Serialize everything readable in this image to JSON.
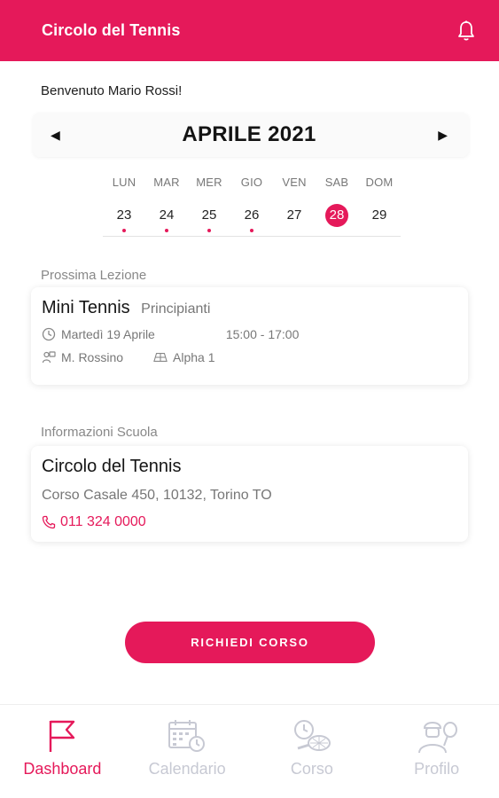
{
  "appbar": {
    "title": "Circolo del Tennis",
    "bell_icon": "bell-icon"
  },
  "welcome": "Benvenuto Mario Rossi!",
  "calendar": {
    "month": "APRILE 2021",
    "prev_arrow": "◀",
    "next_arrow": "▶",
    "days": [
      {
        "name": "LUN",
        "num": "23",
        "dot": true,
        "selected": false
      },
      {
        "name": "MAR",
        "num": "24",
        "dot": true,
        "selected": false
      },
      {
        "name": "MER",
        "num": "25",
        "dot": true,
        "selected": false
      },
      {
        "name": "GIO",
        "num": "26",
        "dot": true,
        "selected": false
      },
      {
        "name": "VEN",
        "num": "27",
        "dot": false,
        "selected": false
      },
      {
        "name": "SAB",
        "num": "28",
        "dot": false,
        "selected": true
      },
      {
        "name": "DOM",
        "num": "29",
        "dot": false,
        "selected": false
      }
    ]
  },
  "next_lesson": {
    "label": "Prossima Lezione",
    "title": "Mini Tennis",
    "level": "Principianti",
    "date": "Martedì 19 Aprile",
    "time": "15:00 - 17:00",
    "instructor": "M. Rossino",
    "court": "Alpha 1"
  },
  "school": {
    "label": "Informazioni Scuola",
    "name": "Circolo del Tennis",
    "address": "Corso Casale 450, 10132, Torino TO",
    "phone": "011 324 0000"
  },
  "cta": "RICHIEDI CORSO",
  "nav": {
    "dashboard": "Dashboard",
    "calendario": "Calendario",
    "corso": "Corso",
    "profilo": "Profilo"
  },
  "colors": {
    "accent": "#e5195a",
    "inactive": "#c7c9d3"
  }
}
